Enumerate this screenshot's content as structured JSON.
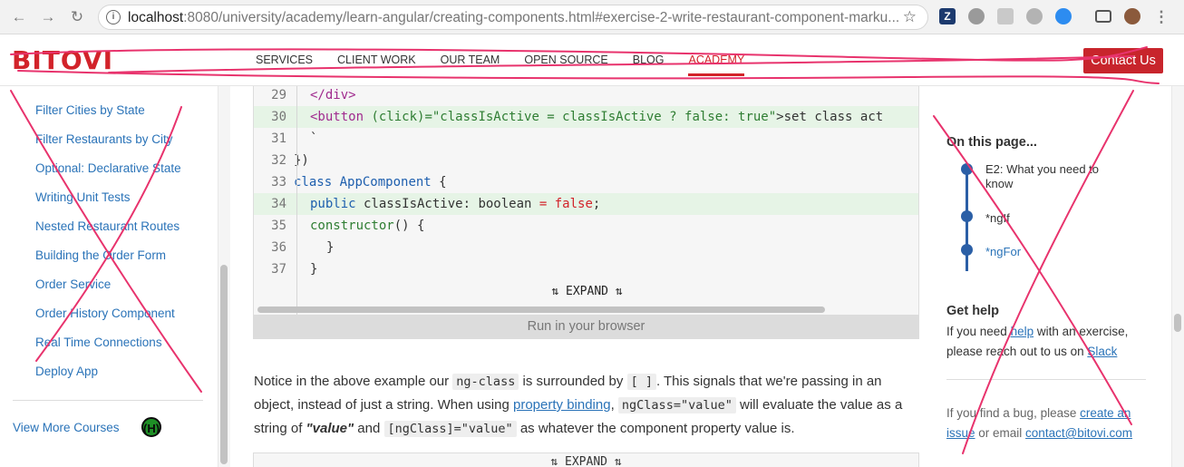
{
  "browser": {
    "url_host": "localhost",
    "url_rest": ":8080/university/academy/learn-angular/creating-components.html#exercise-2-write-restaurant-component-marku...",
    "extensions": [
      "zotero-icon",
      "circle-icon",
      "puzzle-icon",
      "gear-icon",
      "chat-icon",
      "cast-icon",
      "profile-avatar"
    ],
    "colors": {
      "toolbar": "#f2f2f2"
    }
  },
  "site": {
    "logo": "BITOVI",
    "nav": [
      "SERVICES",
      "CLIENT WORK",
      "OUR TEAM",
      "OPEN SOURCE",
      "BLOG",
      "ACADEMY"
    ],
    "active_nav": "ACADEMY",
    "contact_label": "Contact Us",
    "colors": {
      "brand": "#d2232a",
      "link": "#2a73b8"
    }
  },
  "sidebar": {
    "items": [
      "Filter Cities by State",
      "Filter Restaurants by City",
      "Optional: Declarative State",
      "Writing Unit Tests",
      "Nested Restaurant Routes",
      "Building the Order Form",
      "Order Service",
      "Order History Component",
      "Real Time Connections",
      "Deploy App"
    ],
    "view_more": "View More Courses",
    "view_more_icon": "(H)"
  },
  "code": {
    "lines": [
      {
        "num": "29",
        "highlight": false
      },
      {
        "num": "30",
        "highlight": true
      },
      {
        "num": "31",
        "highlight": false
      },
      {
        "num": "32",
        "highlight": false
      },
      {
        "num": "33",
        "highlight": false
      },
      {
        "num": "34",
        "highlight": true
      },
      {
        "num": "35",
        "highlight": false
      },
      {
        "num": "36",
        "highlight": false
      },
      {
        "num": "37",
        "highlight": false
      }
    ],
    "l29": "</div>",
    "l30_tag": "<button",
    "l30_attr": " (click)=",
    "l30_str": "\"classIsActive = classIsActive ? false: true\"",
    "l30_rest": ">set class act",
    "l31": "`",
    "l32": "})",
    "l33_kw": "class",
    "l33_cls": " AppComponent",
    "l33_rest": " {",
    "l34_kw": "public",
    "l34_name": " classIsActive",
    "l34_type": ": boolean ",
    "l34_eq": "=",
    "l34_val": " false",
    "l34_end": ";",
    "l35_fn": "constructor",
    "l35_rest": "() {",
    "l36": "}",
    "l37": "}",
    "expand_label": "⇅ EXPAND ⇅",
    "run_label": "Run in your browser"
  },
  "prose": {
    "p1_a": "Notice in the above example our ",
    "p1_code1": "ng-class",
    "p1_b": " is surrounded by ",
    "p1_code2": "[ ]",
    "p1_c": ". This signals that we're passing in an object, instead of just a string. When using ",
    "p1_link": "property binding",
    "p1_d": ", ",
    "p1_code3": "ngClass=\"value\"",
    "p1_e": " will evaluate the value as a string of ",
    "p1_em": "\"value\"",
    "p1_f": " and ",
    "p1_code4": "[ngClass]=\"value\"",
    "p1_g": " as whatever the component property value is.",
    "expand2": "⇅ EXPAND ⇅"
  },
  "toc": {
    "title": "On this page...",
    "items": [
      "E2: What you need to know",
      "*ngIf",
      "*ngFor"
    ],
    "active_index": 2
  },
  "help": {
    "title": "Get help",
    "text_a": "If you need ",
    "link_help": "help",
    "text_b": " with an exercise, please reach out to us on ",
    "link_slack": "Slack",
    "bug_a": "If you find a bug, please ",
    "link_issue": "create an issue",
    "bug_b": " or email ",
    "link_email": "contact@bitovi.com"
  },
  "annotation": {
    "color": "#e8336d"
  }
}
